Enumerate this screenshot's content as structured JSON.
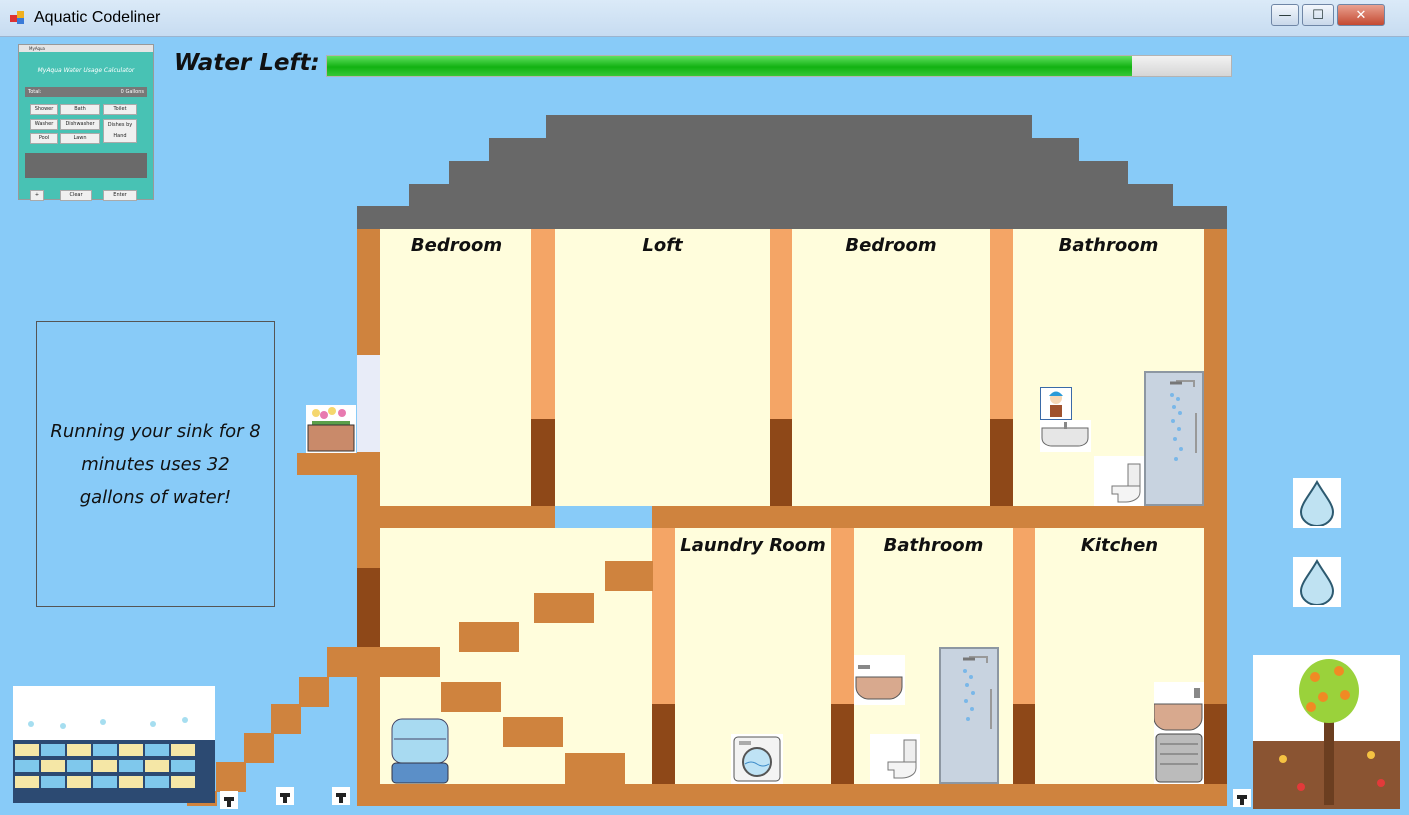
{
  "window": {
    "title": "Aquatic Codeliner",
    "minimize_symbol": "—",
    "maximize_symbol": "☐",
    "close_symbol": "✕"
  },
  "header": {
    "water_label": "Water Left:",
    "water_left_percent": 89
  },
  "mini_calculator": {
    "window_title": "MyAqua",
    "heading": "MyAqua Water Usage Calculator",
    "total_label": "Total:",
    "total_value": "0 Gallons",
    "buttons": [
      "Shower",
      "Bath",
      "Toilet",
      "Washer",
      "Dishwasher",
      "Dishes by Hand",
      "Pool",
      "Lawn"
    ],
    "bottom_buttons": [
      "+",
      "Clear",
      "Enter"
    ]
  },
  "tip": {
    "text": "Running your sink for 8 minutes uses 32 gallons of water!"
  },
  "house": {
    "rooms_upper": [
      "Bedroom",
      "Loft",
      "Bedroom",
      "Bathroom"
    ],
    "rooms_lower": [
      "Laundry Room",
      "Bathroom",
      "Kitchen"
    ]
  },
  "icons": {
    "app": "app-icon",
    "drop": "water-drop-icon",
    "shower": "shower-icon",
    "toilet": "toilet-icon",
    "sink": "sink-icon",
    "washer": "washing-machine-icon",
    "dishwasher": "dishwasher-icon",
    "water_cooler": "water-cooler-icon",
    "tree": "orange-tree-icon",
    "pool": "pool-icon",
    "flower_box": "flower-box-icon",
    "character": "character-icon"
  },
  "colors": {
    "sky": "#88cbf8",
    "roof": "#686868",
    "wall": "#cf833e",
    "room": "#fffddc",
    "water_bar": "#12b212"
  }
}
